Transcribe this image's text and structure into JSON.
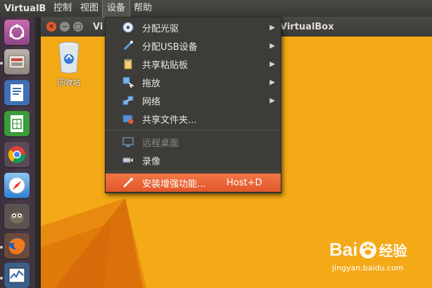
{
  "top_panel": {
    "app_name": "VirtualB",
    "menus": [
      "控制",
      "视图",
      "设备",
      "帮助"
    ]
  },
  "window": {
    "title": "VirtualBox",
    "title_prefix": "Vi"
  },
  "desktop": {
    "icons": [
      {
        "label": "回收站",
        "icon": "recycle-bin-icon"
      }
    ]
  },
  "devices_menu": {
    "items": [
      {
        "label": "分配光驱",
        "icon": "optical-disc-icon",
        "submenu": true,
        "enabled": true
      },
      {
        "label": "分配USB设备",
        "icon": "usb-icon",
        "submenu": true,
        "enabled": true
      },
      {
        "label": "共享粘贴板",
        "icon": "clipboard-icon",
        "submenu": true,
        "enabled": true
      },
      {
        "label": "拖放",
        "icon": "drag-drop-icon",
        "submenu": true,
        "enabled": true
      },
      {
        "label": "网络",
        "icon": "network-icon",
        "submenu": true,
        "enabled": true
      },
      {
        "label": "共享文件夹...",
        "icon": "shared-folder-icon",
        "submenu": false,
        "enabled": true
      },
      {
        "label": "远程桌面",
        "icon": "remote-desktop-icon",
        "submenu": false,
        "enabled": false
      },
      {
        "label": "录像",
        "icon": "video-capture-icon",
        "submenu": false,
        "enabled": true
      },
      {
        "label": "安装增强功能...",
        "icon": "install-guest-additions-icon",
        "submenu": false,
        "enabled": true,
        "shortcut": "Host+D",
        "highlighted": true
      }
    ]
  },
  "launcher": {
    "items": [
      "ubuntu-dash-icon",
      "files-icon",
      "writer-icon",
      "calc-icon",
      "chrome-icon",
      "safari-icon",
      "gimp-icon",
      "firefox-icon",
      "system-monitor-icon"
    ]
  },
  "watermark": {
    "brand": "Bai",
    "brand_suffix": "经验",
    "url": "jingyan.baidu.com"
  },
  "colors": {
    "desktop_bg": "#f4a916",
    "highlight": "#e8602f",
    "panel": "#3d3c38"
  }
}
